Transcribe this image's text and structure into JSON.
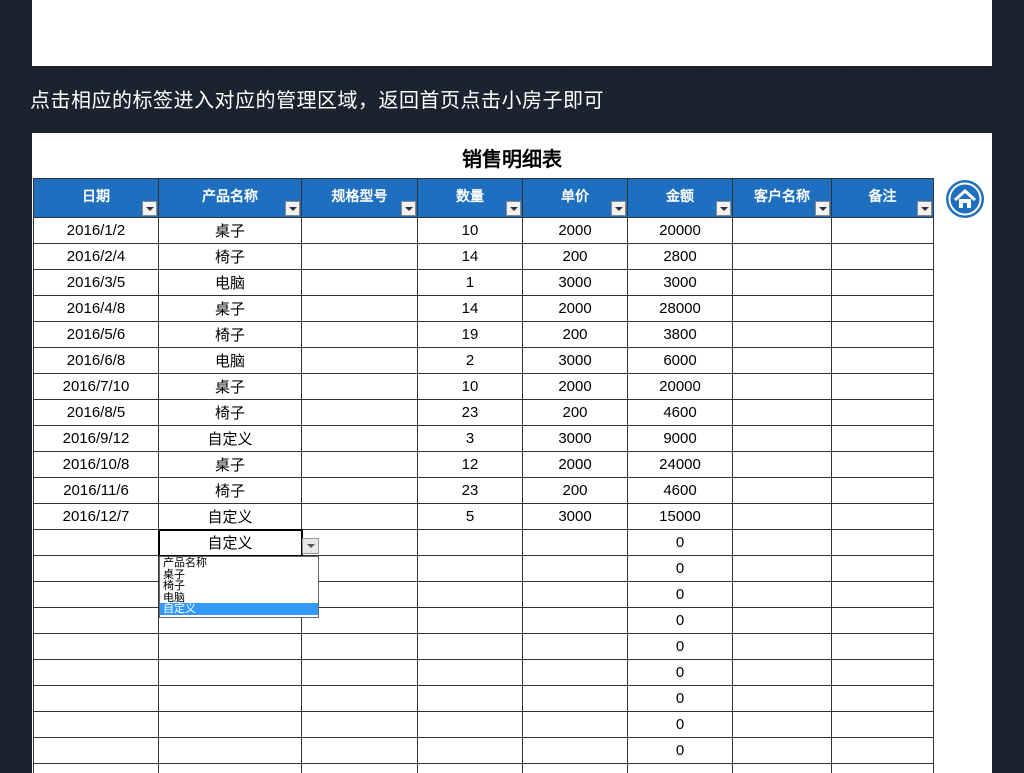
{
  "instruction": "点击相应的标签进入对应的管理区域，返回首页点击小房子即可",
  "sheet": {
    "title": "销售明细表",
    "headers": [
      "日期",
      "产品名称",
      "规格型号",
      "数量",
      "单价",
      "金额",
      "客户名称",
      "备注"
    ],
    "rows": [
      [
        "2016/1/2",
        "桌子",
        "",
        "10",
        "2000",
        "20000",
        "",
        ""
      ],
      [
        "2016/2/4",
        "椅子",
        "",
        "14",
        "200",
        "2800",
        "",
        ""
      ],
      [
        "2016/3/5",
        "电脑",
        "",
        "1",
        "3000",
        "3000",
        "",
        ""
      ],
      [
        "2016/4/8",
        "桌子",
        "",
        "14",
        "2000",
        "28000",
        "",
        ""
      ],
      [
        "2016/5/6",
        "椅子",
        "",
        "19",
        "200",
        "3800",
        "",
        ""
      ],
      [
        "2016/6/8",
        "电脑",
        "",
        "2",
        "3000",
        "6000",
        "",
        ""
      ],
      [
        "2016/7/10",
        "桌子",
        "",
        "10",
        "2000",
        "20000",
        "",
        ""
      ],
      [
        "2016/8/5",
        "椅子",
        "",
        "23",
        "200",
        "4600",
        "",
        ""
      ],
      [
        "2016/9/12",
        "自定义",
        "",
        "3",
        "3000",
        "9000",
        "",
        ""
      ],
      [
        "2016/10/8",
        "桌子",
        "",
        "12",
        "2000",
        "24000",
        "",
        ""
      ],
      [
        "2016/11/6",
        "椅子",
        "",
        "23",
        "200",
        "4600",
        "",
        ""
      ],
      [
        "2016/12/7",
        "自定义",
        "",
        "5",
        "3000",
        "15000",
        "",
        ""
      ],
      [
        "",
        "自定义",
        "",
        "",
        "",
        "0",
        "",
        ""
      ],
      [
        "",
        "",
        "",
        "",
        "",
        "0",
        "",
        ""
      ],
      [
        "",
        "",
        "",
        "",
        "",
        "0",
        "",
        ""
      ],
      [
        "",
        "",
        "",
        "",
        "",
        "0",
        "",
        ""
      ],
      [
        "",
        "",
        "",
        "",
        "",
        "0",
        "",
        ""
      ],
      [
        "",
        "",
        "",
        "",
        "",
        "0",
        "",
        ""
      ],
      [
        "",
        "",
        "",
        "",
        "",
        "0",
        "",
        ""
      ],
      [
        "",
        "",
        "",
        "",
        "",
        "0",
        "",
        ""
      ],
      [
        "",
        "",
        "",
        "",
        "",
        "0",
        "",
        ""
      ],
      [
        "",
        "",
        "",
        "",
        "",
        "",
        "",
        ""
      ]
    ]
  },
  "dropdown": {
    "options": [
      "产品名称",
      "桌子",
      "椅子",
      "电脑",
      "自定义"
    ],
    "selected_index": 4
  },
  "icons": {
    "home": "home-icon"
  },
  "colors": {
    "header_bg": "#1e6fc0",
    "selection": "#3399ff",
    "page_bg": "#1b2230"
  }
}
